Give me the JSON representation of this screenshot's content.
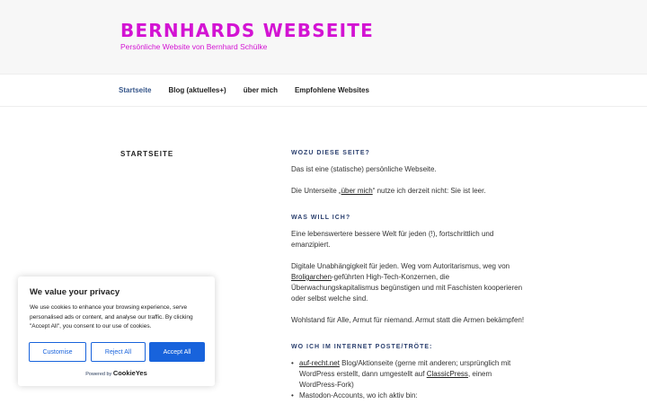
{
  "header": {
    "title": "BERNHARDS WEBSEITE",
    "description": "Persönliche Website von Bernhard Schülke"
  },
  "nav": {
    "items": [
      {
        "label": "Startseite"
      },
      {
        "label": "Blog (aktuelles+)"
      },
      {
        "label": "über mich"
      },
      {
        "label": "Empfohlene Websites"
      }
    ]
  },
  "page": {
    "title": "STARTSEITE"
  },
  "content": {
    "h1": "WOZU DIESE SEITE?",
    "p1": "Das ist eine (statische) persönliche Webseite.",
    "p2_pre": "Die Unterseite „",
    "p2_link": "über mich",
    "p2_post": "“ nutze ich derzeit nicht: Sie ist leer.",
    "h2": "WAS WILL ICH?",
    "p3": "Eine lebenswertere bessere Welt für jeden (!), fortschrittlich und emanzipiert.",
    "p4_pre": "Digitale Unabhängigkeit für jeden. Weg vom Autoritarismus, weg von ",
    "p4_link": "Broligarchen",
    "p4_post": "-geführten High-Tech-Konzernen, die Überwachungskapitalismus begünstigen und mit Faschisten kooperieren oder selbst welche sind.",
    "p5": "Wohlstand für Alle, Armut für niemand. Armut statt die Armen bekämpfen!",
    "h3": "WO ICH IM INTERNET POSTE/TRÖTE:",
    "li1_link": "auf-recht.net",
    "li1_mid": " Blog/Aktionseite (gerne mit anderen; ursprünglich mit WordPress erstellt, dann umgestellt auf ",
    "li1_link2": "ClassicPress",
    "li1_post": ", einem WordPress-Fork)",
    "li2": "Mastodon-Accounts, wo ich aktiv bin:"
  },
  "cookie": {
    "title": "We value your privacy",
    "text": "We use cookies to enhance your browsing experience, serve personalised ads or content, and analyse our traffic. By clicking \"Accept All\", you consent to our use of cookies.",
    "customise": "Customise",
    "reject": "Reject All",
    "accept": "Accept All",
    "powered_by": "Powered by",
    "brand": "CookieYes",
    "accent_color": "#1863dc"
  },
  "colors": {
    "title": "#d313d3",
    "nav_current": "#36568a",
    "heading": "#2a3f6e"
  }
}
